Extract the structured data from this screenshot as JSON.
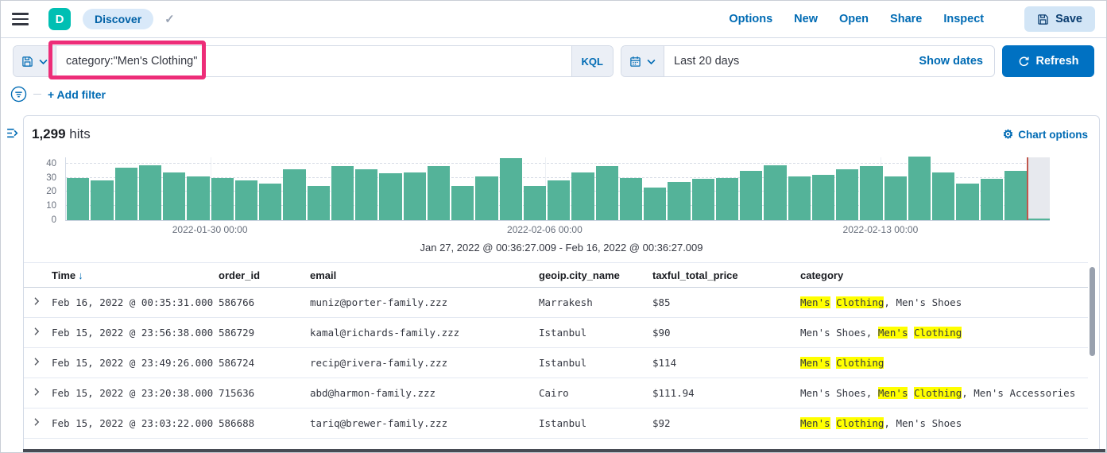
{
  "icons": {
    "check": "✓",
    "gear": "⚙",
    "sort_desc": "↓"
  },
  "topbar": {
    "logo_letter": "D",
    "breadcrumb": "Discover",
    "nav": [
      "Options",
      "New",
      "Open",
      "Share",
      "Inspect"
    ],
    "save_label": "Save"
  },
  "querybar": {
    "query": "category:\"Men's Clothing\"",
    "lang_badge": "KQL",
    "date_range": "Last 20 days",
    "show_dates_label": "Show dates",
    "refresh_label": "Refresh",
    "annotation_color": "#ED2D78"
  },
  "filterbar": {
    "add_filter_label": "+ Add filter"
  },
  "results_header": {
    "hits_count": "1,299",
    "hits_label": "hits",
    "chart_options_label": "Chart options"
  },
  "chart_data": {
    "type": "bar",
    "title": "",
    "xlabel": "",
    "ylabel": "",
    "ylim": [
      0,
      45
    ],
    "y_ticks": [
      0,
      10,
      20,
      30,
      40
    ],
    "grid": true,
    "legend": false,
    "bar_color": "#54B399",
    "current_time_marker_color": "#C0564C",
    "values": [
      30,
      28,
      37,
      39,
      34,
      31,
      30,
      28,
      26,
      36,
      24,
      38,
      36,
      33,
      34,
      38,
      24,
      31,
      44,
      24,
      28,
      34,
      38,
      30,
      23,
      27,
      29,
      30,
      35,
      39,
      31,
      32,
      36,
      38,
      31,
      45,
      34,
      26,
      29,
      35
    ],
    "partial_bucket_value": 1,
    "x_tick_labels": [
      "2022-01-30 00:00",
      "2022-02-06 00:00",
      "2022-02-13 00:00"
    ],
    "x_tick_positions_pct": [
      14.7,
      48.7,
      82.8
    ],
    "caption": "Jan 27, 2022 @ 00:36:27.009 - Feb 16, 2022 @ 00:36:27.009"
  },
  "table": {
    "columns": [
      "Time",
      "order_id",
      "email",
      "geoip.city_name",
      "taxful_total_price",
      "category"
    ],
    "highlight_color": "#FFFF00",
    "rows": [
      {
        "time": "Feb 16, 2022 @ 00:35:31.000",
        "order_id": "586766",
        "email": "muniz@porter-family.zzz",
        "geoip_city_name": "Marrakesh",
        "taxful_total_price": "$85",
        "category": [
          {
            "text": "Men's",
            "highlight": true
          },
          {
            "text": " ",
            "highlight": false
          },
          {
            "text": "Clothing",
            "highlight": true
          },
          {
            "text": ", Men's Shoes",
            "highlight": false
          }
        ]
      },
      {
        "time": "Feb 15, 2022 @ 23:56:38.000",
        "order_id": "586729",
        "email": "kamal@richards-family.zzz",
        "geoip_city_name": "Istanbul",
        "taxful_total_price": "$90",
        "category": [
          {
            "text": "Men's Shoes, ",
            "highlight": false
          },
          {
            "text": "Men's",
            "highlight": true
          },
          {
            "text": " ",
            "highlight": false
          },
          {
            "text": "Clothing",
            "highlight": true
          }
        ]
      },
      {
        "time": "Feb 15, 2022 @ 23:49:26.000",
        "order_id": "586724",
        "email": "recip@rivera-family.zzz",
        "geoip_city_name": "Istanbul",
        "taxful_total_price": "$114",
        "category": [
          {
            "text": "Men's",
            "highlight": true
          },
          {
            "text": " ",
            "highlight": false
          },
          {
            "text": "Clothing",
            "highlight": true
          }
        ]
      },
      {
        "time": "Feb 15, 2022 @ 23:20:38.000",
        "order_id": "715636",
        "email": "abd@harmon-family.zzz",
        "geoip_city_name": "Cairo",
        "taxful_total_price": "$111.94",
        "category": [
          {
            "text": "Men's Shoes, ",
            "highlight": false
          },
          {
            "text": "Men's",
            "highlight": true
          },
          {
            "text": " ",
            "highlight": false
          },
          {
            "text": "Clothing",
            "highlight": true
          },
          {
            "text": ", Men's Accessories",
            "highlight": false
          }
        ]
      },
      {
        "time": "Feb 15, 2022 @ 23:03:22.000",
        "order_id": "586688",
        "email": "tariq@brewer-family.zzz",
        "geoip_city_name": "Istanbul",
        "taxful_total_price": "$92",
        "category": [
          {
            "text": "Men's",
            "highlight": true
          },
          {
            "text": " ",
            "highlight": false
          },
          {
            "text": "Clothing",
            "highlight": true
          },
          {
            "text": ", Men's Shoes",
            "highlight": false
          }
        ]
      }
    ]
  }
}
